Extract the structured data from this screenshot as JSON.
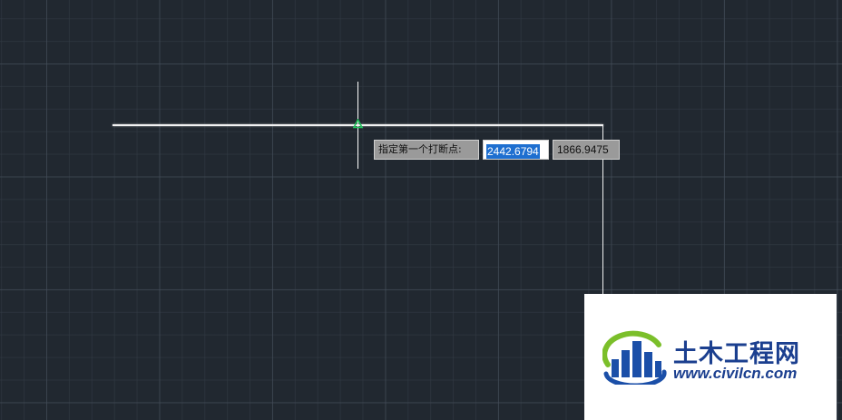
{
  "prompt": {
    "label": "指定第一个打断点:"
  },
  "coordinates": {
    "x_value": "2442.6794",
    "y_value": "1866.9475"
  },
  "watermark": {
    "site_name": "土木工程网",
    "url": "www.civilcn.com"
  },
  "colors": {
    "background": "#212830",
    "line": "#f2f2f2",
    "snap_marker": "#22c55e",
    "selection": "#1e6fd0",
    "logo_blue": "#1b3f8f",
    "logo_green": "#7bbf2a"
  }
}
